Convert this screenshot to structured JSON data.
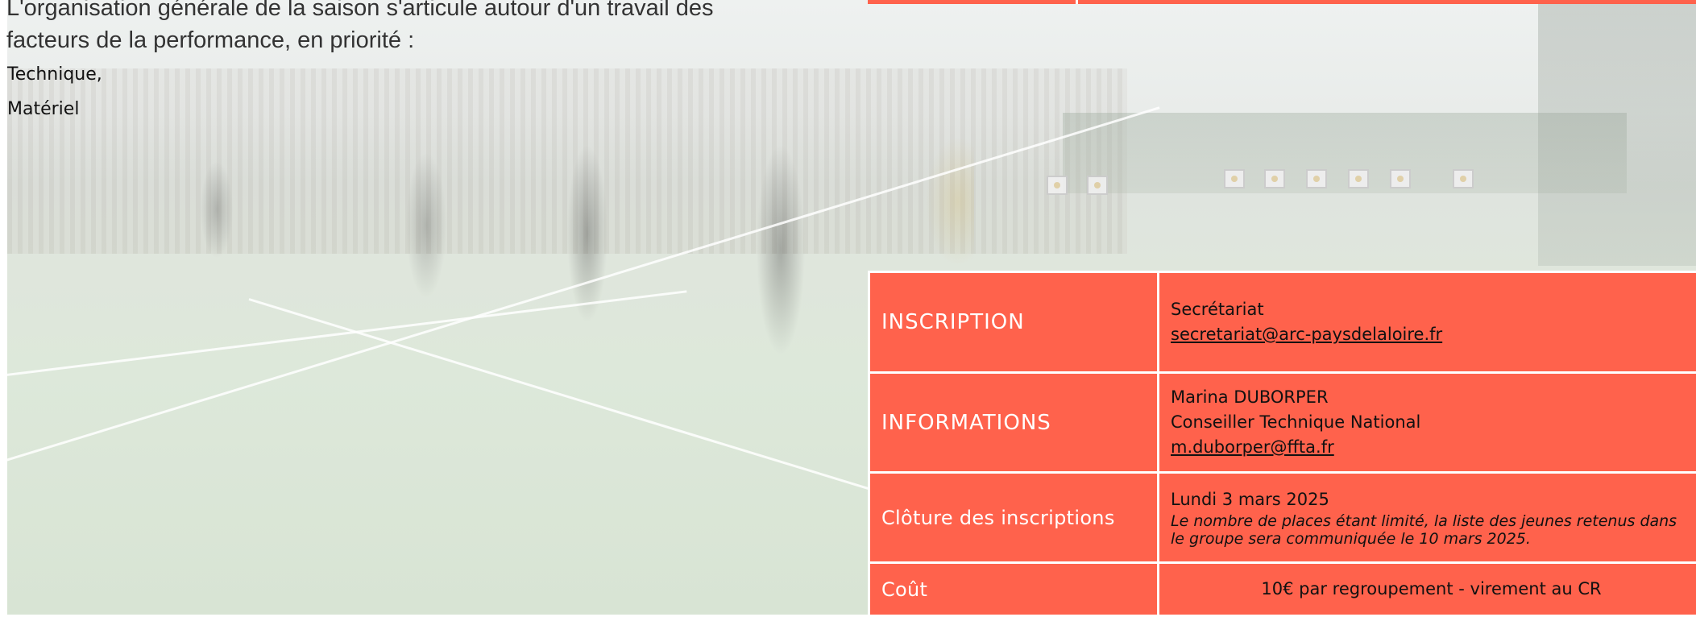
{
  "intro": {
    "line1": "L'organisation générale de la saison s'articule autour d'un travail des",
    "line2": "facteurs de la performance, en priorité :"
  },
  "list": [
    "Technique,",
    "Matériel"
  ],
  "table": {
    "inscription": {
      "label": "INSCRIPTION",
      "line1": "Secrétariat",
      "email": "secretariat@arc-paysdelaloire.fr"
    },
    "informations": {
      "label": "INFORMATIONS",
      "line1": "Marina DUBORPER",
      "line2": "Conseiller Technique National",
      "email": "m.duborper@ffta.fr"
    },
    "cloture": {
      "label": "Clôture des inscriptions",
      "date": "Lundi 3 mars 2025",
      "note": "Le nombre de places étant limité, la liste des jeunes retenus dans le groupe sera communiquée le 10 mars 2025."
    },
    "cout": {
      "label": "Coût",
      "value": "10€ par regroupement - virement au CR"
    }
  },
  "colors": {
    "accent": "#ff624c",
    "text": "#111111"
  }
}
